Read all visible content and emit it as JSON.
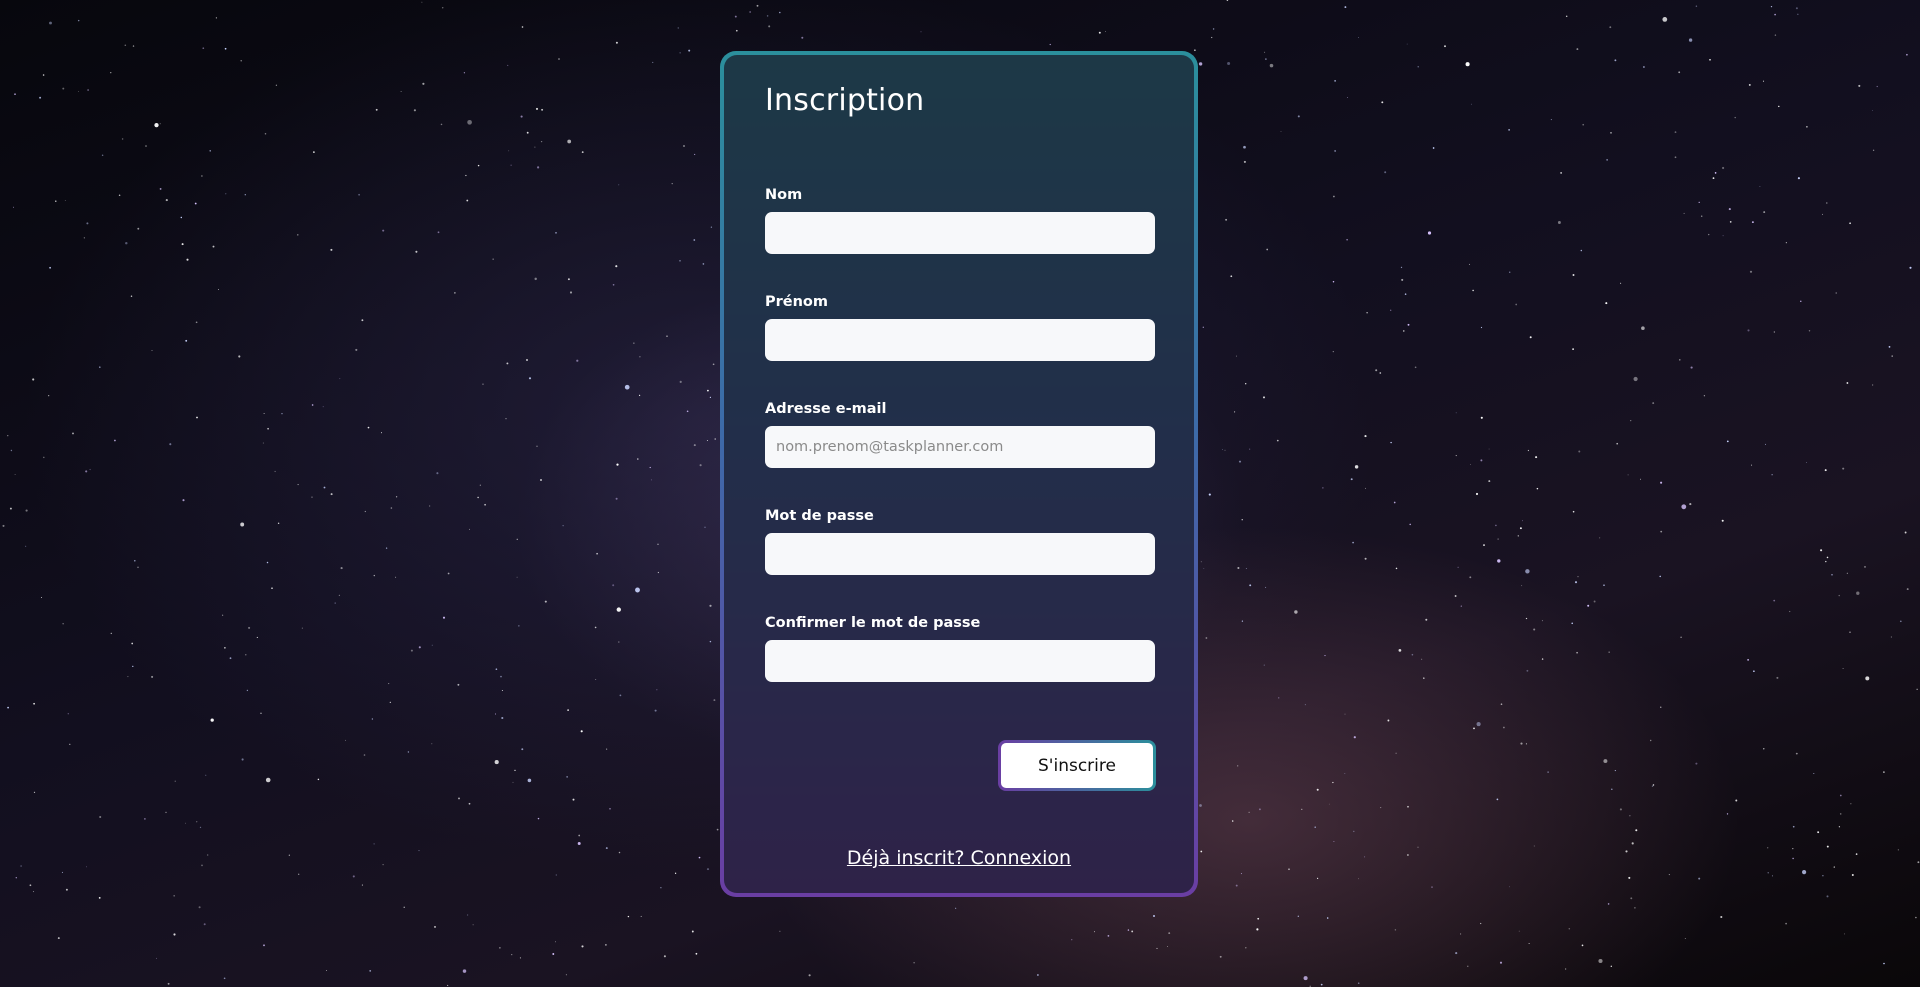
{
  "form": {
    "title": "Inscription",
    "fields": [
      {
        "label": "Nom",
        "value": "",
        "placeholder": ""
      },
      {
        "label": "Prénom",
        "value": "",
        "placeholder": ""
      },
      {
        "label": "Adresse e-mail",
        "value": "",
        "placeholder": "nom.prenom@taskplanner.com"
      },
      {
        "label": "Mot de passe",
        "value": "",
        "placeholder": ""
      },
      {
        "label": "Confirmer le mot de passe",
        "value": "",
        "placeholder": ""
      }
    ],
    "submit_label": "S'inscrire",
    "login_link": "Déjà inscrit? Connexion"
  },
  "colors": {
    "border_start": "#2b8f9c",
    "border_end": "#6a3ea3",
    "input_bg": "#f7f8fa",
    "text": "#ffffff"
  }
}
